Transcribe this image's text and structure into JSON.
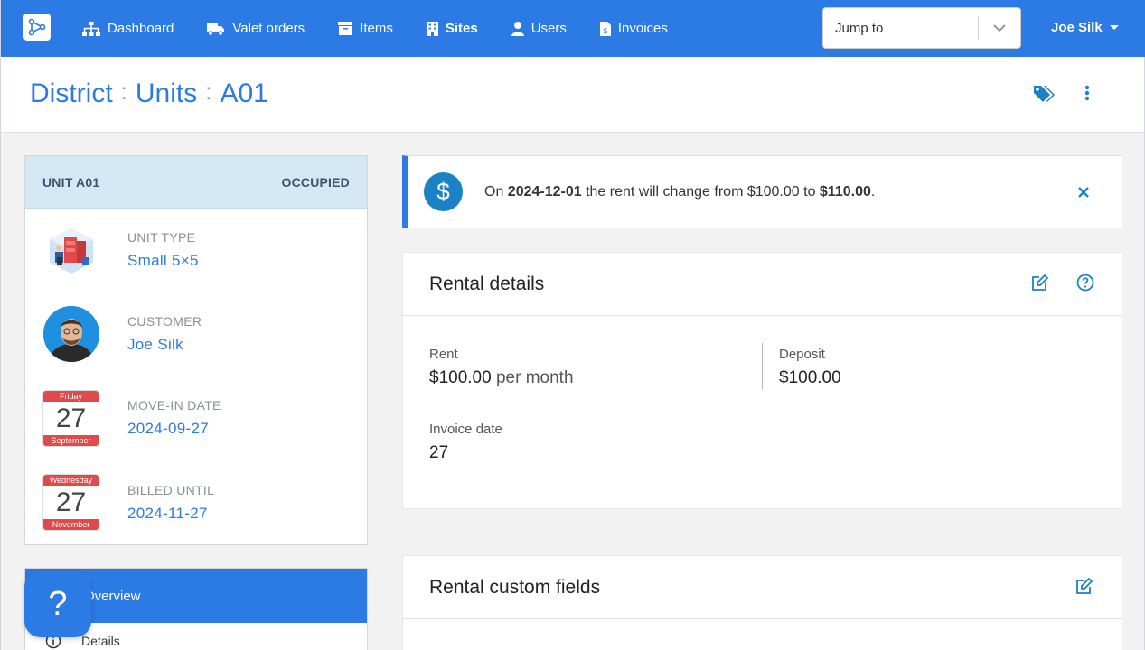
{
  "nav": {
    "items": [
      {
        "label": "Dashboard",
        "icon": "sitemap-icon"
      },
      {
        "label": "Valet orders",
        "icon": "truck-icon"
      },
      {
        "label": "Items",
        "icon": "archive-icon"
      },
      {
        "label": "Sites",
        "icon": "building-icon",
        "active": true
      },
      {
        "label": "Users",
        "icon": "user-icon"
      },
      {
        "label": "Invoices",
        "icon": "invoice-icon"
      }
    ],
    "jump_placeholder": "Jump to",
    "user_name": "Joe Silk"
  },
  "breadcrumb": [
    "District",
    "Units",
    "A01"
  ],
  "unit": {
    "title": "UNIT A01",
    "status": "OCCUPIED",
    "rows": [
      {
        "label": "UNIT TYPE",
        "value": "Small 5×5"
      },
      {
        "label": "CUSTOMER",
        "value": "Joe Silk"
      },
      {
        "label": "MOVE-IN DATE",
        "value": "2024-09-27",
        "cal": {
          "weekday": "Friday",
          "day": "27",
          "month": "September"
        }
      },
      {
        "label": "BILLED UNTIL",
        "value": "2024-11-27",
        "cal": {
          "weekday": "Wednesday",
          "day": "27",
          "month": "November"
        }
      }
    ]
  },
  "menu": {
    "overview": "Overview",
    "details": "Details",
    "help": "?"
  },
  "notice": {
    "pre": "On ",
    "date": "2024-12-01",
    "mid": " the rent will change from $100.00 to ",
    "new_rent": "$110.00",
    "post": "."
  },
  "rental": {
    "title": "Rental details",
    "rent_label": "Rent",
    "rent_value": "$100.00",
    "rent_period": "per month",
    "deposit_label": "Deposit",
    "deposit_value": "$100.00",
    "invoice_label": "Invoice date",
    "invoice_value": "27"
  },
  "custom": {
    "title": "Rental custom fields"
  },
  "colors": {
    "accent": "#2c7be5",
    "header_bg": "#d5e8f5",
    "calendar_red": "#e04a4a"
  }
}
